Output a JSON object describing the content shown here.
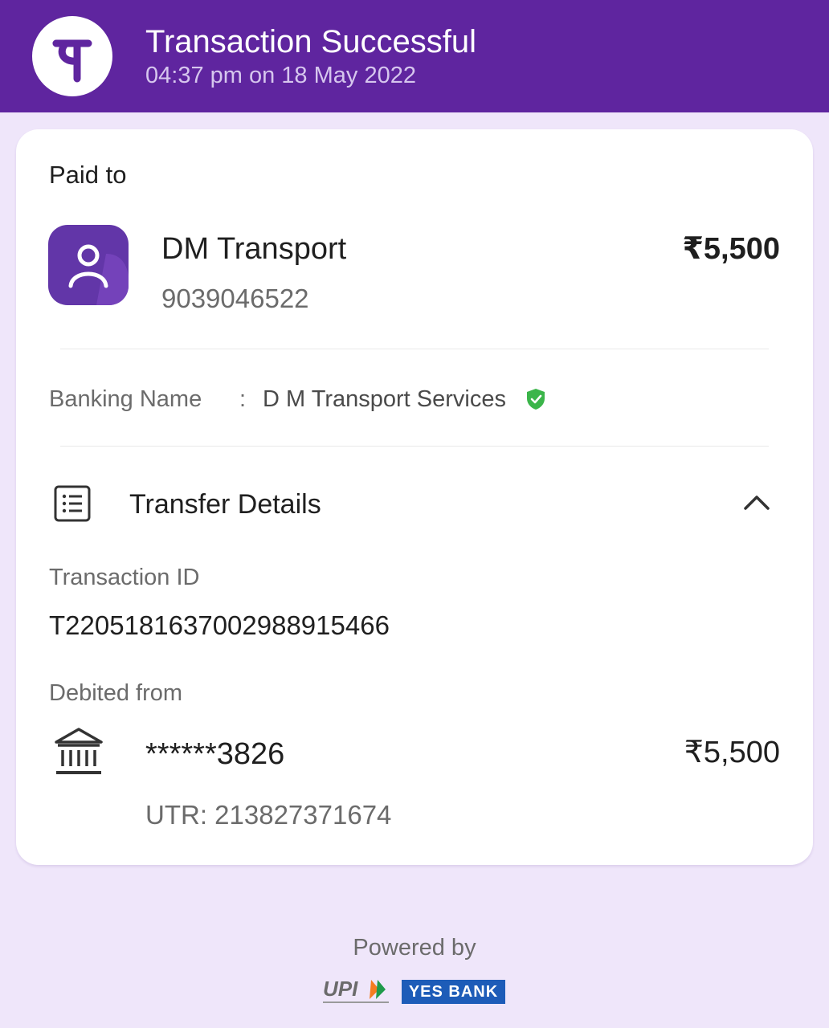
{
  "header": {
    "title": "Transaction Successful",
    "timestamp": "04:37 pm on 18 May 2022",
    "logo_icon": "phonepe-logo-icon",
    "background_color": "#5f259f"
  },
  "payment": {
    "paid_to_label": "Paid to",
    "payee_name": "DM Transport",
    "payee_phone": "9039046522",
    "amount": "₹5,500",
    "avatar_icon": "person-icon"
  },
  "banking": {
    "label": "Banking Name",
    "separator": ":",
    "value": "D M Transport Services",
    "verified_icon": "verified-shield-icon",
    "verified_color": "#3bb54a"
  },
  "transfer_details": {
    "title": "Transfer Details",
    "icon": "document-list-icon",
    "toggle_icon": "chevron-up-icon",
    "transaction_id_label": "Transaction ID",
    "transaction_id": "T2205181637002988915466",
    "debited_from_label": "Debited from",
    "account": "******3826",
    "amount": "₹5,500",
    "utr": "UTR: 213827371674",
    "bank_icon": "bank-icon"
  },
  "footer": {
    "powered_by": "Powered by",
    "upi_logo": "upi-logo",
    "bank_logo_text": "YES BANK"
  }
}
